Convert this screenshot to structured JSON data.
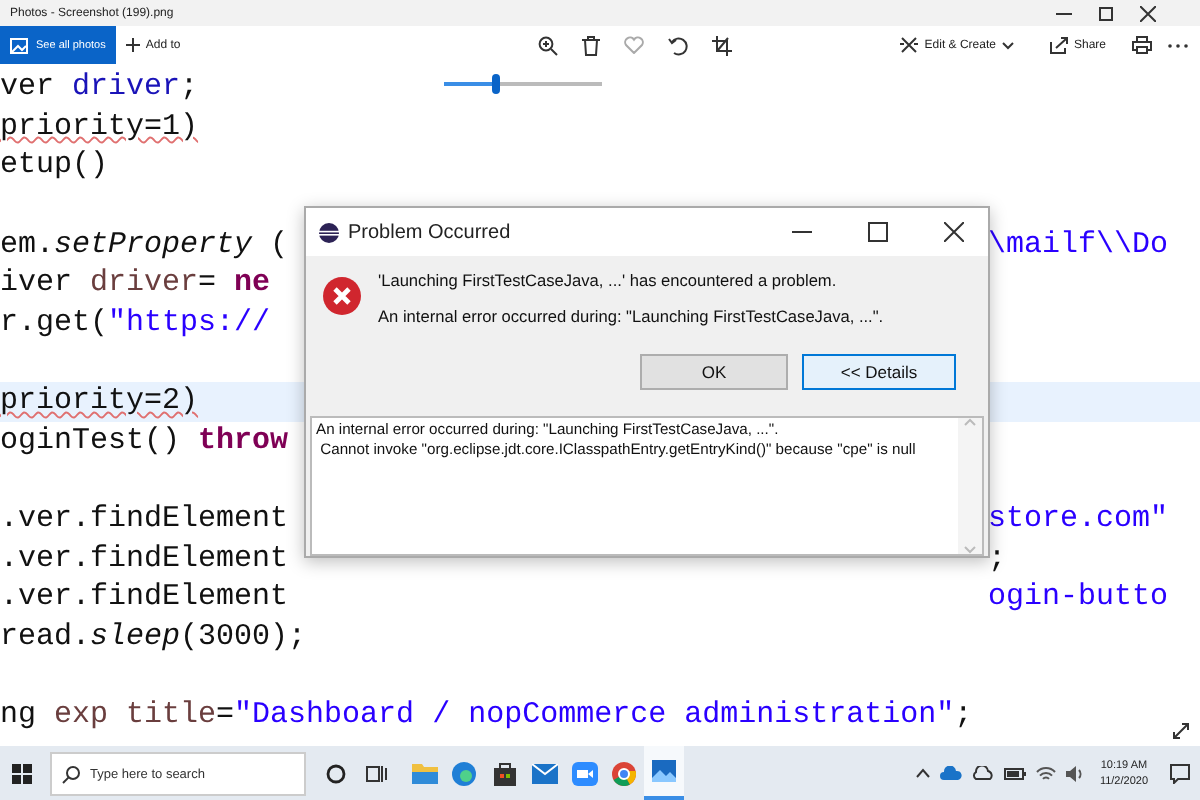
{
  "app": {
    "title": "Photos - Screenshot (199).png",
    "see_all": "See all photos",
    "add_to": "Add to",
    "edit_create": "Edit & Create",
    "share": "Share"
  },
  "zoom_slider": {
    "level": 0.33
  },
  "code_blocks": [
    [
      {
        "segments": [
          {
            "text": "ver ",
            "kind": "plain"
          },
          {
            "text": "driver",
            "kind": "field"
          },
          {
            "text": ";",
            "kind": "plain"
          }
        ]
      },
      {
        "segments": [
          {
            "text": "priority=1)",
            "kind": "warn"
          }
        ]
      },
      {
        "segments": [
          {
            "text": "etup()",
            "kind": "plain"
          }
        ]
      }
    ],
    [
      {
        "segments": [
          {
            "text": "em.",
            "kind": "plain"
          },
          {
            "text": "setProperty",
            "kind": "italic"
          },
          {
            "text": " (",
            "kind": "plain"
          }
        ],
        "right": [
          {
            "text": "\\mailf\\\\Do",
            "kind": "string"
          }
        ]
      },
      {
        "segments": [
          {
            "text": "iver ",
            "kind": "plain"
          },
          {
            "text": "driver",
            "kind": "local"
          },
          {
            "text": "= ",
            "kind": "plain"
          },
          {
            "text": "ne",
            "kind": "keyword"
          }
        ]
      },
      {
        "segments": [
          {
            "text": "r.get(",
            "kind": "plain"
          },
          {
            "text": "\"https://",
            "kind": "string"
          }
        ]
      }
    ],
    [
      {
        "segments": [
          {
            "text": "priority=2)",
            "kind": "warn"
          }
        ],
        "highlighted": true
      },
      {
        "segments": [
          {
            "text": "oginTest() ",
            "kind": "plain"
          },
          {
            "text": "throw",
            "kind": "keyword"
          }
        ]
      }
    ],
    [
      {
        "segments": [
          {
            "text": ".ver.findElement",
            "kind": "plain"
          }
        ],
        "right": [
          {
            "text": "store.com\"",
            "kind": "string"
          }
        ]
      },
      {
        "segments": [
          {
            "text": ".ver.findElement",
            "kind": "plain"
          }
        ],
        "right": [
          {
            "text": ";",
            "kind": "plain"
          }
        ]
      },
      {
        "segments": [
          {
            "text": ".ver.findElement",
            "kind": "plain"
          }
        ],
        "right": [
          {
            "text": "ogin-butto",
            "kind": "string"
          }
        ]
      },
      {
        "segments": [
          {
            "text": "read.",
            "kind": "plain"
          },
          {
            "text": "sleep",
            "kind": "italic"
          },
          {
            "text": "(3000);",
            "kind": "plain"
          }
        ]
      }
    ],
    [
      {
        "segments": [
          {
            "text": "ng ",
            "kind": "plain"
          },
          {
            "text": "exp title",
            "kind": "local"
          },
          {
            "text": "=",
            "kind": "plain"
          },
          {
            "text": "\"Dashboard / nopCommerce administration\"",
            "kind": "string"
          },
          {
            "text": ";",
            "kind": "plain"
          }
        ]
      }
    ]
  ],
  "dialog": {
    "title": "Problem Occurred",
    "message": "'Launching FirstTestCaseJava, ...' has encountered a problem.",
    "detail_line": "An internal error occurred during: \"Launching FirstTestCaseJava, ...\".",
    "buttons": [
      {
        "label": "OK",
        "focused": false
      },
      {
        "label": "<< Details",
        "focused": true
      }
    ],
    "details": "An internal error occurred during: \"Launching FirstTestCaseJava, ...\".\n Cannot invoke \"org.eclipse.jdt.core.IClasspathEntry.getEntryKind()\" because \"cpe\" is null"
  },
  "taskbar": {
    "search_placeholder": "Type here to search",
    "apps": [
      {
        "kind": "folder",
        "active": false
      },
      {
        "kind": "browser",
        "active": false
      },
      {
        "kind": "bag",
        "active": false
      },
      {
        "kind": "mail",
        "active": false
      },
      {
        "kind": "camera",
        "active": false
      },
      {
        "kind": "chrome",
        "active": false
      },
      {
        "kind": "photos",
        "active": true
      }
    ],
    "time": "10:19 AM",
    "date": "11/2/2020"
  }
}
